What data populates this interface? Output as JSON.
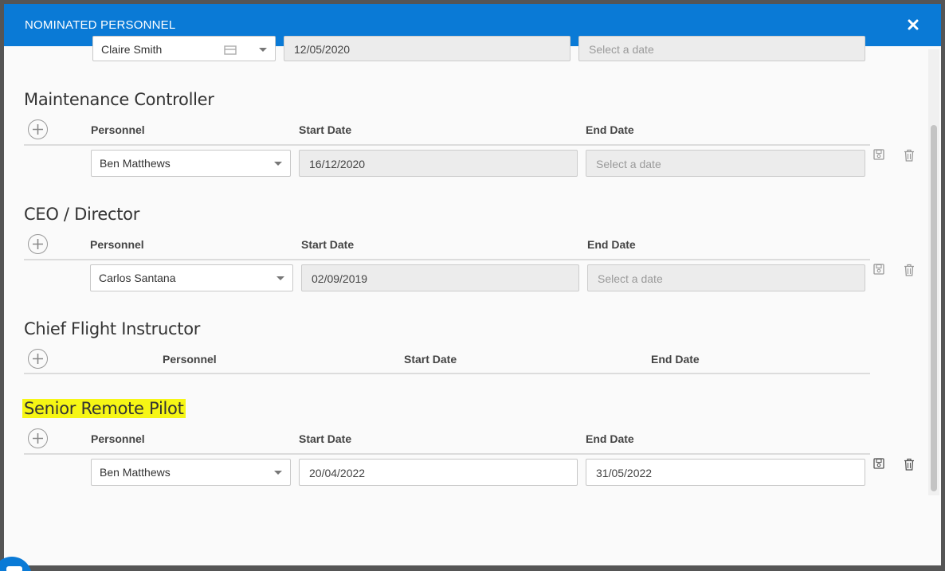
{
  "modal": {
    "title": "NOMINATED PERSONNEL",
    "close_icon": "close-icon",
    "header_color": "#0a7ad6"
  },
  "partial_row": {
    "personnel": "Claire Smith",
    "start_date": "12/05/2020",
    "end_date_placeholder": "Select a date"
  },
  "sections": [
    {
      "title": "Maintenance Controller",
      "columns": {
        "personnel": "Personnel",
        "start": "Start Date",
        "end": "End Date"
      },
      "row": {
        "personnel": "Ben Matthews",
        "start_date": "16/12/2020",
        "end_date_placeholder": "Select a date"
      }
    },
    {
      "title": "CEO / Director",
      "columns": {
        "personnel": "Personnel",
        "start": "Start Date",
        "end": "End Date"
      },
      "row": {
        "personnel": "Carlos Santana",
        "start_date": "02/09/2019",
        "end_date_placeholder": "Select a date"
      }
    },
    {
      "title": "Chief Flight Instructor",
      "columns": {
        "personnel": "Personnel",
        "start": "Start Date",
        "end": "End Date"
      }
    },
    {
      "title": "Senior Remote Pilot",
      "highlight_color": "#f6f615",
      "columns": {
        "personnel": "Personnel",
        "start": "Start Date",
        "end": "End Date"
      },
      "row": {
        "personnel": "Ben Matthews",
        "start_date": "20/04/2022",
        "end_date": "31/05/2022"
      }
    }
  ],
  "icons": [
    "plus-icon",
    "save-icon",
    "trash-icon",
    "calendar-icon",
    "chevron-down-icon"
  ]
}
